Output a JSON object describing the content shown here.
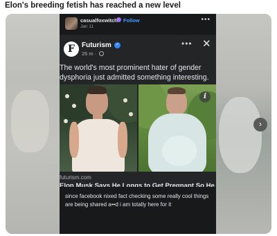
{
  "post": {
    "title": "Elon's breeding fetish has reached a new level"
  },
  "fb_header": {
    "username": "casualfoxwitch",
    "follow_label": "Follow",
    "date": "Jan 11",
    "more": "•••"
  },
  "card": {
    "source_name": "Futurism",
    "source_logo_letter": "F",
    "time": "26 m ·",
    "more": "•••",
    "close": "✕",
    "text": "The world's most prominent hater of gender dysphoria just admitted something interesting.",
    "info": "i",
    "link_domain": "futurism.com",
    "link_headline": "Elon Musk Says He Longs to Get Pregnant So He Can Produce as Many Children as Possible"
  },
  "comment": {
    "text": "since facebook nixed fact checking some really cool things are being shared a••d i am totally here for it"
  },
  "nav": {
    "next": "›"
  },
  "colors": {
    "fb_dark": "#242526",
    "fb_blue": "#2d88ff",
    "follow_blue": "#4599ff"
  }
}
